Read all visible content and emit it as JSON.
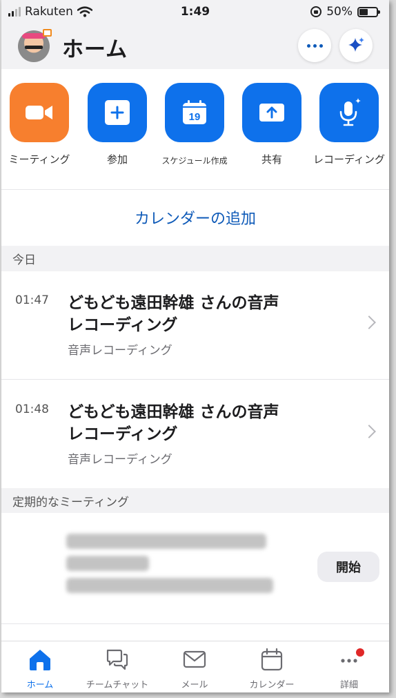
{
  "status_bar": {
    "carrier": "Rakuten",
    "time": "1:49",
    "battery": "50%",
    "battery_level": 0.5
  },
  "header": {
    "title": "ホーム"
  },
  "quick_actions": [
    {
      "label": "ミーティング",
      "icon": "video-camera-icon",
      "color": "#f77f2e"
    },
    {
      "label": "参加",
      "icon": "plus-icon",
      "color": "#0e71eb"
    },
    {
      "label": "スケジュール作成",
      "icon": "calendar-icon",
      "color": "#0e71eb",
      "calendar_day": "19"
    },
    {
      "label": "共有",
      "icon": "share-screen-icon",
      "color": "#0e71eb"
    },
    {
      "label": "レコーディング",
      "icon": "microphone-icon",
      "color": "#0e71eb"
    }
  ],
  "add_calendar": "カレンダーの追加",
  "today": {
    "header": "今日",
    "items": [
      {
        "time": "01:47",
        "title_line1": "どもども遠田幹雄 さんの音声",
        "title_line2": "レコーディング",
        "subtitle": "音声レコーディング"
      },
      {
        "time": "01:48",
        "title_line1": "どもども遠田幹雄 さんの音声",
        "title_line2": "レコーディング",
        "subtitle": "音声レコーディング"
      }
    ]
  },
  "recurring": {
    "header": "定期的なミーティング",
    "start_label": "開始"
  },
  "tab_bar": [
    {
      "label": "ホーム",
      "icon": "home-icon",
      "active": true
    },
    {
      "label": "チームチャット",
      "icon": "chat-icon",
      "active": false
    },
    {
      "label": "メール",
      "icon": "mail-icon",
      "active": false
    },
    {
      "label": "カレンダー",
      "icon": "calendar-icon",
      "active": false
    },
    {
      "label": "詳細",
      "icon": "more-icon",
      "active": false,
      "badge": true
    }
  ],
  "colors": {
    "accent": "#0e71eb",
    "link": "#0e5ab8",
    "orange": "#f77f2e",
    "badge": "#e02828"
  }
}
